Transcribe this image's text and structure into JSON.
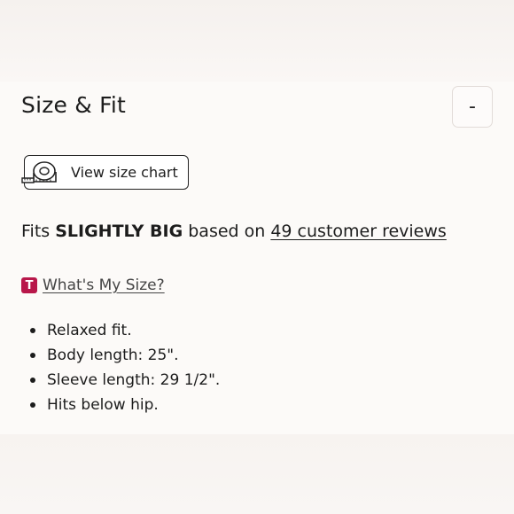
{
  "section": {
    "title": "Size & Fit",
    "collapse_label": "-"
  },
  "size_chart": {
    "label": "View size chart",
    "icon": "tape-measure-icon"
  },
  "fit": {
    "prefix": "Fits ",
    "rating": "SLIGHTLY BIG",
    "middle": " based on ",
    "reviews_link": "49 customer reviews"
  },
  "whats_my_size": {
    "badge": "T",
    "label": "What's My Size?",
    "badge_color": "#b8174a"
  },
  "details": [
    "Relaxed fit.",
    "Body length: 25\".",
    "Sleeve length: 29 1/2\".",
    "Hits below hip."
  ]
}
